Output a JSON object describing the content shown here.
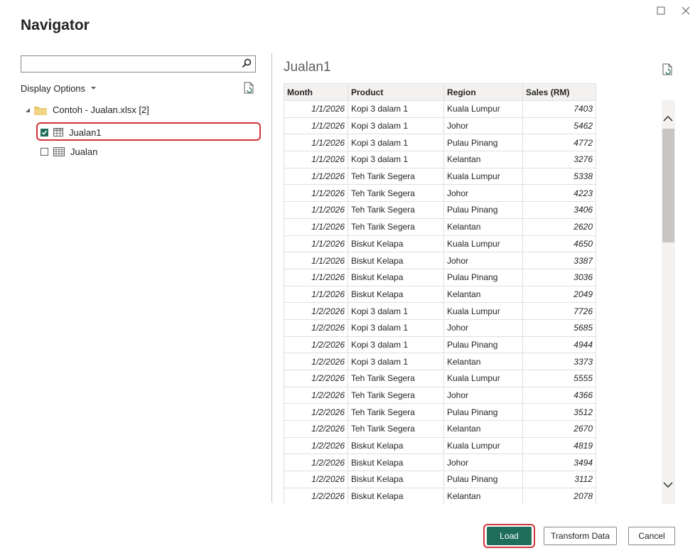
{
  "window": {
    "title": "Navigator",
    "controls": [
      "maximize",
      "close"
    ]
  },
  "sidebar": {
    "search": {
      "value": "",
      "placeholder": ""
    },
    "display_options_label": "Display Options",
    "tree": {
      "root_label": "Contoh - Jualan.xlsx [2]",
      "items": [
        {
          "label": "Jualan1",
          "checked": true,
          "icon": "table-icon"
        },
        {
          "label": "Jualan",
          "checked": false,
          "icon": "sheet-icon"
        }
      ]
    }
  },
  "preview": {
    "title": "Jualan1",
    "columns": [
      "Month",
      "Product",
      "Region",
      "Sales (RM)"
    ],
    "rows": [
      [
        "1/1/2026",
        "Kopi 3 dalam 1",
        "Kuala Lumpur",
        "7403"
      ],
      [
        "1/1/2026",
        "Kopi 3 dalam 1",
        "Johor",
        "5462"
      ],
      [
        "1/1/2026",
        "Kopi 3 dalam 1",
        "Pulau Pinang",
        "4772"
      ],
      [
        "1/1/2026",
        "Kopi 3 dalam 1",
        "Kelantan",
        "3276"
      ],
      [
        "1/1/2026",
        "Teh Tarik Segera",
        "Kuala Lumpur",
        "5338"
      ],
      [
        "1/1/2026",
        "Teh Tarik Segera",
        "Johor",
        "4223"
      ],
      [
        "1/1/2026",
        "Teh Tarik Segera",
        "Pulau Pinang",
        "3406"
      ],
      [
        "1/1/2026",
        "Teh Tarik Segera",
        "Kelantan",
        "2620"
      ],
      [
        "1/1/2026",
        "Biskut Kelapa",
        "Kuala Lumpur",
        "4650"
      ],
      [
        "1/1/2026",
        "Biskut Kelapa",
        "Johor",
        "3387"
      ],
      [
        "1/1/2026",
        "Biskut Kelapa",
        "Pulau Pinang",
        "3036"
      ],
      [
        "1/1/2026",
        "Biskut Kelapa",
        "Kelantan",
        "2049"
      ],
      [
        "1/2/2026",
        "Kopi 3 dalam 1",
        "Kuala Lumpur",
        "7726"
      ],
      [
        "1/2/2026",
        "Kopi 3 dalam 1",
        "Johor",
        "5685"
      ],
      [
        "1/2/2026",
        "Kopi 3 dalam 1",
        "Pulau Pinang",
        "4944"
      ],
      [
        "1/2/2026",
        "Kopi 3 dalam 1",
        "Kelantan",
        "3373"
      ],
      [
        "1/2/2026",
        "Teh Tarik Segera",
        "Kuala Lumpur",
        "5555"
      ],
      [
        "1/2/2026",
        "Teh Tarik Segera",
        "Johor",
        "4366"
      ],
      [
        "1/2/2026",
        "Teh Tarik Segera",
        "Pulau Pinang",
        "3512"
      ],
      [
        "1/2/2026",
        "Teh Tarik Segera",
        "Kelantan",
        "2670"
      ],
      [
        "1/2/2026",
        "Biskut Kelapa",
        "Kuala Lumpur",
        "4819"
      ],
      [
        "1/2/2026",
        "Biskut Kelapa",
        "Johor",
        "3494"
      ],
      [
        "1/2/2026",
        "Biskut Kelapa",
        "Pulau Pinang",
        "3112"
      ],
      [
        "1/2/2026",
        "Biskut Kelapa",
        "Kelantan",
        "2078"
      ]
    ]
  },
  "footer": {
    "load_label": "Load",
    "transform_label": "Transform Data",
    "cancel_label": "Cancel"
  },
  "colors": {
    "accent": "#1e6e5a",
    "highlight": "#d13438",
    "folder": "#e8c26a"
  }
}
